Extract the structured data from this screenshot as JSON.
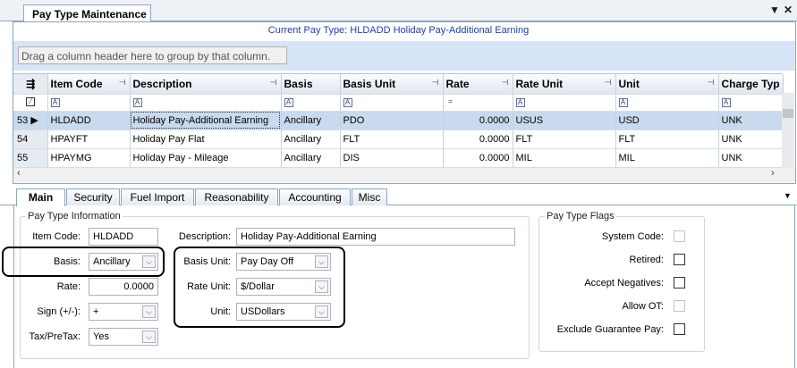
{
  "window": {
    "tab_title": "Pay Type Maintenance",
    "dropdown_glyph": "▼",
    "close_glyph": "✕"
  },
  "header": {
    "current_pay_type": "Current Pay Type: HLDADD Holiday Pay-Additional Earning",
    "group_hint": "Drag a column header here to group by that column."
  },
  "grid": {
    "columns": [
      "Item Code",
      "Description",
      "Basis",
      "Basis Unit",
      "Rate",
      "Rate Unit",
      "Unit",
      "Charge Typ"
    ],
    "rows": [
      {
        "row_no": "53",
        "item_code": "HLDADD",
        "description": "Holiday Pay-Additional Earning",
        "basis": "Ancillary",
        "basis_unit": "PDO",
        "rate": "0.0000",
        "rate_unit": "USUS",
        "unit": "USD",
        "charge_type": "UNK"
      },
      {
        "row_no": "54",
        "item_code": "HPAYFT",
        "description": "Holiday Pay Flat",
        "basis": "Ancillary",
        "basis_unit": "FLT",
        "rate": "0.0000",
        "rate_unit": "FLT",
        "unit": "FLT",
        "charge_type": "UNK"
      },
      {
        "row_no": "55",
        "item_code": "HPAYMG",
        "description": "Holiday Pay - Mileage",
        "basis": "Ancillary",
        "basis_unit": "DIS",
        "rate": "0.0000",
        "rate_unit": "MIL",
        "unit": "MIL",
        "charge_type": "UNK"
      }
    ],
    "filter_glyph": "A",
    "rate_filter_glyph": "="
  },
  "tabs": [
    "Main",
    "Security",
    "Fuel Import",
    "Reasonability",
    "Accounting",
    "Misc"
  ],
  "pay_type_info": {
    "legend": "Pay Type Information",
    "item_code_label": "Item Code:",
    "item_code": "HLDADD",
    "basis_label": "Basis:",
    "basis": "Ancillary",
    "rate_label": "Rate:",
    "rate": "0.0000",
    "sign_label": "Sign (+/-):",
    "sign": "+",
    "taxpretax_label": "Tax/PreTax:",
    "taxpretax": "Yes",
    "description_label": "Description:",
    "description": "Holiday Pay-Additional Earning",
    "basis_unit_label": "Basis Unit:",
    "basis_unit": "Pay Day Off",
    "rate_unit_label": "Rate Unit:",
    "rate_unit": "$/Dollar",
    "unit_label": "Unit:",
    "unit": "USDollars"
  },
  "flags": {
    "legend": "Pay Type Flags",
    "system_code_label": "System Code:",
    "retired_label": "Retired:",
    "accept_negatives_label": "Accept Negatives:",
    "allow_ot_label": "Allow OT:",
    "exclude_guarantee_label": "Exclude Guarantee Pay:"
  }
}
